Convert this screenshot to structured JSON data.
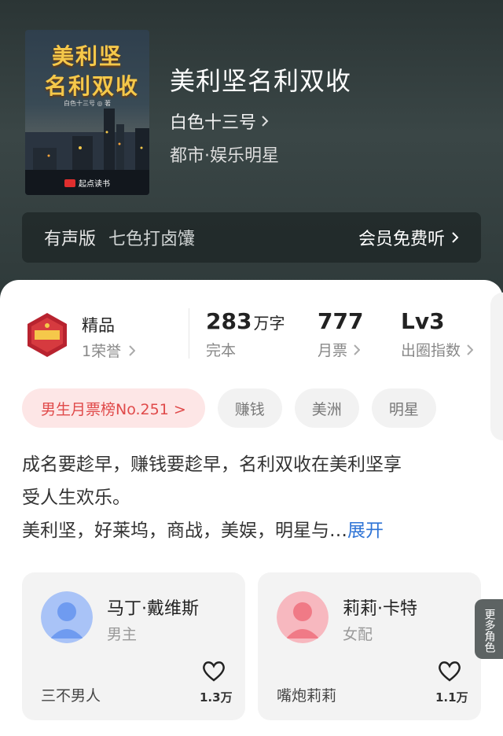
{
  "book": {
    "cover_title_line1": "美利坚",
    "cover_title_line2": "名利双收",
    "cover_author": "白色十三号 ◎ 著",
    "cover_publisher": "起点读书",
    "cover_badge": "起点",
    "title": "美利坚名利双收",
    "author": "白色十三号",
    "genre": "都市·娱乐明星"
  },
  "audio": {
    "label": "有声版",
    "narrator": "七色打卤馕",
    "action": "会员免费听"
  },
  "stats": {
    "honor_title": "精品",
    "honor_sub": "1荣誉",
    "word_count_value": "283",
    "word_count_unit": "万字",
    "word_count_label": "完本",
    "monthly_votes_value": "777",
    "monthly_votes_label": "月票",
    "index_value": "Lv3",
    "index_label": "出圈指数"
  },
  "tags": [
    "男生月票榜No.251 >",
    "赚钱",
    "美洲",
    "明星"
  ],
  "description": {
    "line1": "成名要趁早，赚钱要趁早，名利双收在美利坚享",
    "line2": "受人生欢乐。",
    "line3": "美利坚，好莱坞，商战，美娱，明星与…",
    "more": "展开"
  },
  "characters": [
    {
      "name": "马丁·戴维斯",
      "role": "男主",
      "tag": "三不男人",
      "likes": "1.3万",
      "color": "#6f9bf0"
    },
    {
      "name": "莉莉·卡特",
      "role": "女配",
      "tag": "嘴炮莉莉",
      "likes": "1.1万",
      "color": "#f07a86"
    }
  ],
  "more_roles": "更多角色",
  "colors": {
    "accent": "#2f74d6",
    "rank": "#e04a4a"
  }
}
